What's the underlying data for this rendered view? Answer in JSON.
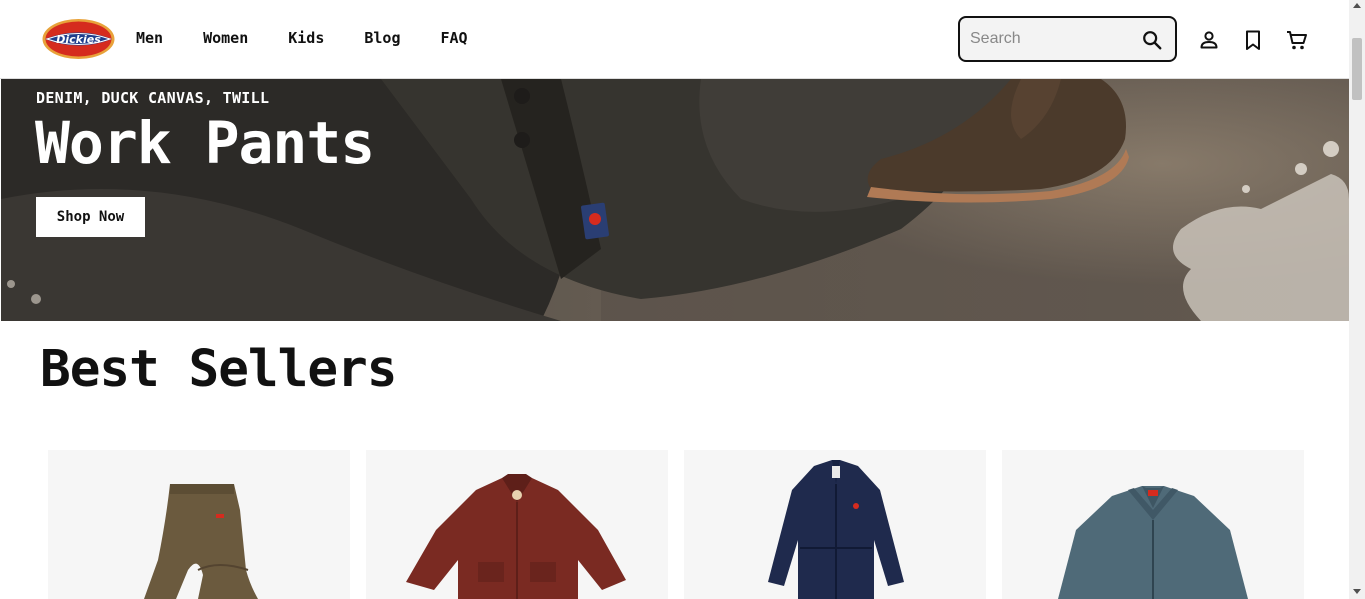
{
  "header": {
    "logo_text": "Dickies",
    "nav": [
      "Men",
      "Women",
      "Kids",
      "Blog",
      "FAQ"
    ],
    "search_placeholder": "Search",
    "icons": [
      "search-icon",
      "user-icon",
      "bookmark-icon",
      "cart-icon"
    ]
  },
  "hero": {
    "eyebrow": "DENIM, DUCK CANVAS, TWILL",
    "title": "Work Pants",
    "button": "Shop Now"
  },
  "best_sellers": {
    "title": "Best Sellers",
    "products": [
      {
        "image": "khaki-work-pants"
      },
      {
        "image": "maroon-short-sleeve-work-shirt"
      },
      {
        "image": "navy-coverall"
      },
      {
        "image": "slate-eisenhower-jacket"
      }
    ]
  },
  "colors": {
    "accent": "#111111",
    "logo_red": "#d52b1e",
    "logo_blue": "#1f3e8c",
    "card_bg": "#f6f6f6"
  }
}
